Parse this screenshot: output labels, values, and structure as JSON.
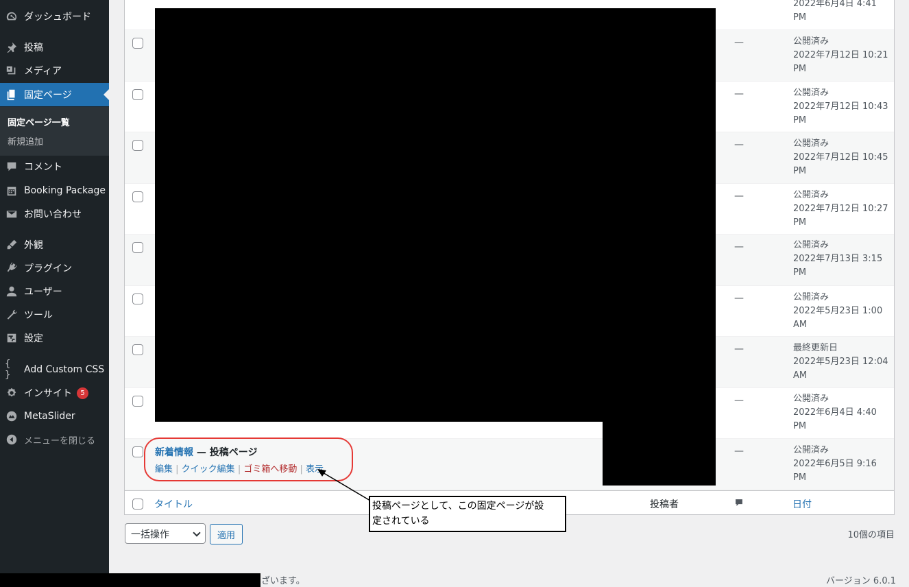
{
  "sidebar": {
    "items": [
      {
        "label": "ダッシュボード",
        "icon": "dashboard-icon"
      },
      {
        "label": "投稿",
        "icon": "pin-icon"
      },
      {
        "label": "メディア",
        "icon": "media-icon"
      },
      {
        "label": "固定ページ",
        "icon": "pages-icon"
      },
      {
        "label": "コメント",
        "icon": "comment-icon"
      },
      {
        "label": "Booking Package",
        "icon": "calendar-icon"
      },
      {
        "label": "お問い合わせ",
        "icon": "mail-icon"
      },
      {
        "label": "外観",
        "icon": "brush-icon"
      },
      {
        "label": "プラグイン",
        "icon": "plugin-icon"
      },
      {
        "label": "ユーザー",
        "icon": "user-icon"
      },
      {
        "label": "ツール",
        "icon": "wrench-icon"
      },
      {
        "label": "設定",
        "icon": "settings-icon"
      },
      {
        "label": "Add Custom CSS",
        "icon": "braces-icon"
      },
      {
        "label": "インサイト",
        "icon": "insight-icon",
        "badge": "5"
      },
      {
        "label": "MetaSlider",
        "icon": "metaslider-icon"
      },
      {
        "label": "メニューを閉じる",
        "icon": "collapse-icon"
      }
    ],
    "submenu": [
      "固定ページ一覧",
      "新規追加"
    ]
  },
  "table": {
    "rows": [
      {
        "author": "",
        "date": [
          "2022年6月4日 4:41",
          "PM"
        ]
      },
      {
        "author": "—",
        "date": [
          "公開済み",
          "2022年7月12日 10:21",
          "PM"
        ]
      },
      {
        "author": "—",
        "date": [
          "公開済み",
          "2022年7月12日 10:43",
          "PM"
        ]
      },
      {
        "author": "—",
        "date": [
          "公開済み",
          "2022年7月12日 10:45",
          "PM"
        ]
      },
      {
        "author": "—",
        "date": [
          "公開済み",
          "2022年7月12日 10:27",
          "PM"
        ]
      },
      {
        "author": "—",
        "date": [
          "公開済み",
          "2022年7月13日 3:15",
          "PM"
        ]
      },
      {
        "author": "—",
        "date": [
          "公開済み",
          "2022年5月23日 1:00",
          "AM"
        ]
      },
      {
        "author": "—",
        "date": [
          "最終更新日",
          "2022年5月23日 12:04",
          "AM"
        ]
      },
      {
        "author": "—",
        "date": [
          "公開済み",
          "2022年6月4日 4:40",
          "PM"
        ]
      },
      {
        "author": "—",
        "date": [
          "公開済み",
          "2022年6月5日 9:16",
          "PM"
        ]
      }
    ],
    "last_row": {
      "title": "新着情報",
      "suffix": " — 投稿ページ",
      "actions": {
        "edit": "編集",
        "quick_edit": "クイック編集",
        "trash": "ゴミ箱へ移動",
        "view": "表示"
      }
    },
    "footer": {
      "title": "タイトル",
      "author": "投稿者",
      "date": "日付"
    }
  },
  "bulk": {
    "select_value": "一括操作",
    "apply": "適用",
    "count": "10個の項目"
  },
  "footer": {
    "thanks": "ざいます。",
    "version": "バージョン 6.0.1"
  },
  "annotation": {
    "line1": "投稿ページとして、この固定ページが設",
    "line2": "定されている"
  }
}
